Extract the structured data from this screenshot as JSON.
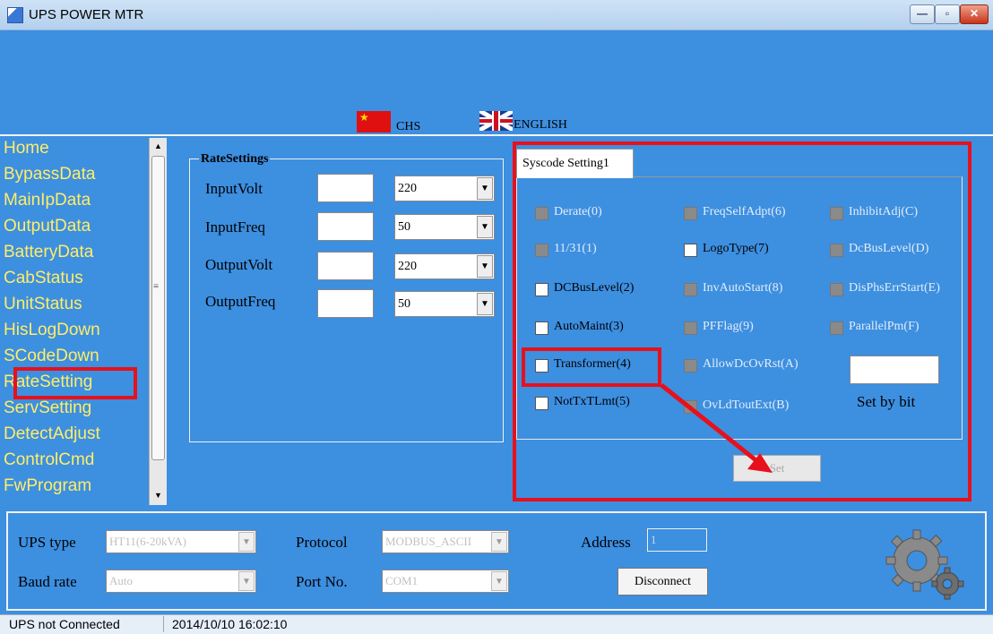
{
  "window": {
    "title": "UPS POWER MTR",
    "minimize_label": "—",
    "maximize_label": "▫",
    "close_label": "✕"
  },
  "language": {
    "chs_label": "CHS",
    "english_label": "ENGLISH"
  },
  "nav": {
    "items": [
      {
        "label": "Home"
      },
      {
        "label": "BypassData"
      },
      {
        "label": "MainIpData"
      },
      {
        "label": "OutputData"
      },
      {
        "label": "BatteryData"
      },
      {
        "label": "CabStatus"
      },
      {
        "label": "UnitStatus"
      },
      {
        "label": "HisLogDown"
      },
      {
        "label": "SCodeDown"
      },
      {
        "label": "RateSetting"
      },
      {
        "label": "ServSetting"
      },
      {
        "label": "DetectAdjust"
      },
      {
        "label": "ControlCmd"
      },
      {
        "label": "FwProgram"
      }
    ],
    "selected": "RateSetting"
  },
  "rate_settings": {
    "legend": "RateSettings",
    "rows": [
      {
        "label": "InputVolt",
        "input_value": "",
        "select_value": "220"
      },
      {
        "label": "InputFreq",
        "input_value": "",
        "select_value": "50"
      },
      {
        "label": "OutputVolt",
        "input_value": "",
        "select_value": "220"
      },
      {
        "label": "OutputFreq",
        "input_value": "",
        "select_value": "50"
      }
    ]
  },
  "syscode": {
    "tab_label": "Syscode Setting1",
    "checkboxes": [
      {
        "label": "Derate(0)",
        "enabled": false
      },
      {
        "label": "11/31(1)",
        "enabled": false
      },
      {
        "label": "DCBusLevel(2)",
        "enabled": true
      },
      {
        "label": "AutoMaint(3)",
        "enabled": true
      },
      {
        "label": "Transformer(4)",
        "enabled": true
      },
      {
        "label": "NotTxTLmt(5)",
        "enabled": true
      },
      {
        "label": "FreqSelfAdpt(6)",
        "enabled": false
      },
      {
        "label": "LogoType(7)",
        "enabled": true
      },
      {
        "label": "InvAutoStart(8)",
        "enabled": false
      },
      {
        "label": "PFFlag(9)",
        "enabled": false
      },
      {
        "label": "AllowDcOvRst(A)",
        "enabled": false
      },
      {
        "label": "OvLdToutExt(B)",
        "enabled": false
      },
      {
        "label": "InhibitAdj(C)",
        "enabled": false
      },
      {
        "label": "DcBusLevel(D)",
        "enabled": false
      },
      {
        "label": "DisPhsErrStart(E)",
        "enabled": false
      },
      {
        "label": "ParallelPm(F)",
        "enabled": false
      }
    ],
    "set_by_bit_label": "Set by bit",
    "set_by_bit_value": "",
    "set_button_label": "Set"
  },
  "connection": {
    "ups_type_label": "UPS type",
    "ups_type_value": "HT11(6-20kVA)",
    "baud_rate_label": "Baud rate",
    "baud_rate_value": "Auto",
    "protocol_label": "Protocol",
    "protocol_value": "MODBUS_ASCII",
    "port_label": "Port No.",
    "port_value": "COM1",
    "address_label": "Address",
    "address_value": "1",
    "disconnect_label": "Disconnect"
  },
  "status": {
    "connection": "UPS not Connected",
    "datetime": "2014/10/10 16:02:10"
  },
  "colors": {
    "background": "#3d8fe0",
    "nav_text": "#ffee66",
    "highlight_red": "#e8101a"
  }
}
